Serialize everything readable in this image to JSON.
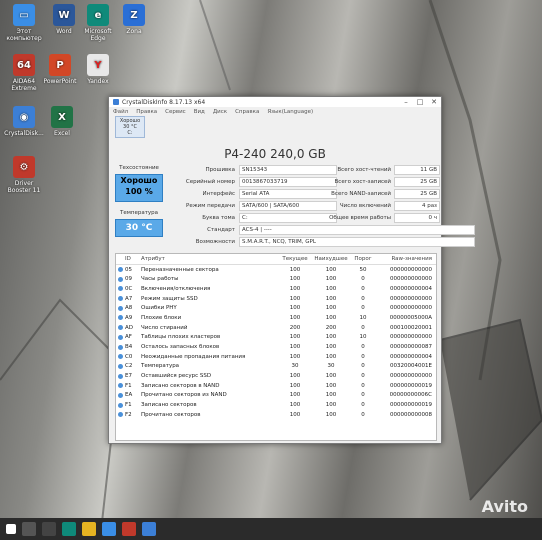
{
  "desktop_icons": [
    {
      "name": "computer",
      "label": "Этот компьютер",
      "color": "#3a8ee6",
      "glyph": "▭"
    },
    {
      "name": "word",
      "label": "Word",
      "color": "#2b579a",
      "glyph": "W"
    },
    {
      "name": "edge",
      "label": "Microsoft Edge",
      "color": "#0f8a7a",
      "glyph": "e"
    },
    {
      "name": "zona",
      "label": "Zona",
      "color": "#2a6fd6",
      "glyph": "Z"
    },
    {
      "name": "aida",
      "label": "AIDA64 Extreme",
      "color": "#c0392b",
      "glyph": "64"
    },
    {
      "name": "powerpoint",
      "label": "PowerPoint",
      "color": "#d24726",
      "glyph": "P"
    },
    {
      "name": "yandex",
      "label": "Yandex",
      "color": "#e8e8e8",
      "glyph": "Y"
    },
    {
      "name": "crystaldisk",
      "label": "CrystalDisk...",
      "color": "#3c7fd6",
      "glyph": "◉"
    },
    {
      "name": "excel",
      "label": "Excel",
      "color": "#217346",
      "glyph": "X"
    },
    {
      "name": "driverbooster",
      "label": "Driver Booster 11",
      "color": "#c0392b",
      "glyph": "⚙"
    }
  ],
  "window": {
    "title": "CrystalDiskInfo 8.17.13 x64",
    "menu": [
      "Файл",
      "Правка",
      "Сервис",
      "Вид",
      "Диск",
      "Справка",
      "Язык(Language)"
    ],
    "drive_tab": {
      "status": "Хорошо",
      "temp": "30 °C",
      "letter": "C:"
    },
    "model": "P4-240 240,0 GB",
    "health_label": "Техсостояние",
    "health_status": "Хорошо",
    "health_percent": "100 %",
    "temp_label": "Температура",
    "temp_value": "30 °C",
    "info_left": [
      {
        "k": "Прошивка",
        "v": "SN15343"
      },
      {
        "k": "Серийный номер",
        "v": "0013867033719"
      },
      {
        "k": "Интерфейс",
        "v": "Serial ATA"
      },
      {
        "k": "Режим передачи",
        "v": "SATA/600 | SATA/600"
      },
      {
        "k": "Буква тома",
        "v": "C:"
      }
    ],
    "info_right": [
      {
        "k": "Всего хост-чтений",
        "v": "11 GB"
      },
      {
        "k": "Всего хост-записей",
        "v": "25 GB"
      },
      {
        "k": "Всего NAND-записей",
        "v": "25 GB"
      },
      {
        "k": "Число включений",
        "v": "4 раз"
      },
      {
        "k": "Общее время работы",
        "v": "0 ч"
      }
    ],
    "standard_label": "Стандарт",
    "standard_value": "ACS-4 | ----",
    "features_label": "Возможности",
    "features_value": "S.M.A.R.T., NCQ, TRIM, GPL",
    "table_headers": {
      "id": "ID",
      "attr": "Атрибут",
      "cur": "Текущее",
      "worst": "Наихудшее",
      "thr": "Порог",
      "raw": "Raw-значения"
    },
    "rows": [
      {
        "id": "05",
        "attr": "Переназначенные сектора",
        "cur": "100",
        "worst": "100",
        "thr": "50",
        "raw": "000000000000"
      },
      {
        "id": "09",
        "attr": "Часы работы",
        "cur": "100",
        "worst": "100",
        "thr": "0",
        "raw": "000000000000"
      },
      {
        "id": "0C",
        "attr": "Включения/отключения",
        "cur": "100",
        "worst": "100",
        "thr": "0",
        "raw": "000000000004"
      },
      {
        "id": "A7",
        "attr": "Режим защиты SSD",
        "cur": "100",
        "worst": "100",
        "thr": "0",
        "raw": "000000000000"
      },
      {
        "id": "A8",
        "attr": "Ошибки PHY",
        "cur": "100",
        "worst": "100",
        "thr": "0",
        "raw": "000000000000"
      },
      {
        "id": "A9",
        "attr": "Плохие блоки",
        "cur": "100",
        "worst": "100",
        "thr": "10",
        "raw": "00000005000A"
      },
      {
        "id": "AD",
        "attr": "Число стираний",
        "cur": "200",
        "worst": "200",
        "thr": "0",
        "raw": "000100020001"
      },
      {
        "id": "AF",
        "attr": "Таблицы плохих кластеров",
        "cur": "100",
        "worst": "100",
        "thr": "10",
        "raw": "000000000000"
      },
      {
        "id": "B4",
        "attr": "Осталось запасных блоков",
        "cur": "100",
        "worst": "100",
        "thr": "0",
        "raw": "000000000087"
      },
      {
        "id": "C0",
        "attr": "Неожиданные пропадания питания",
        "cur": "100",
        "worst": "100",
        "thr": "0",
        "raw": "000000000004"
      },
      {
        "id": "C2",
        "attr": "Температура",
        "cur": "30",
        "worst": "30",
        "thr": "0",
        "raw": "00320004001E"
      },
      {
        "id": "E7",
        "attr": "Оставшийся ресурс SSD",
        "cur": "100",
        "worst": "100",
        "thr": "0",
        "raw": "000000000000"
      },
      {
        "id": "F1",
        "attr": "Записано секторов в NAND",
        "cur": "100",
        "worst": "100",
        "thr": "0",
        "raw": "000000000019"
      },
      {
        "id": "EA",
        "attr": "Прочитано секторов из NAND",
        "cur": "100",
        "worst": "100",
        "thr": "0",
        "raw": "00000000006C"
      },
      {
        "id": "F1",
        "attr": "Записано секторов",
        "cur": "100",
        "worst": "100",
        "thr": "0",
        "raw": "000000000019"
      },
      {
        "id": "F2",
        "attr": "Прочитано секторов",
        "cur": "100",
        "worst": "100",
        "thr": "0",
        "raw": "000000000008"
      }
    ]
  },
  "watermark": "Avito"
}
